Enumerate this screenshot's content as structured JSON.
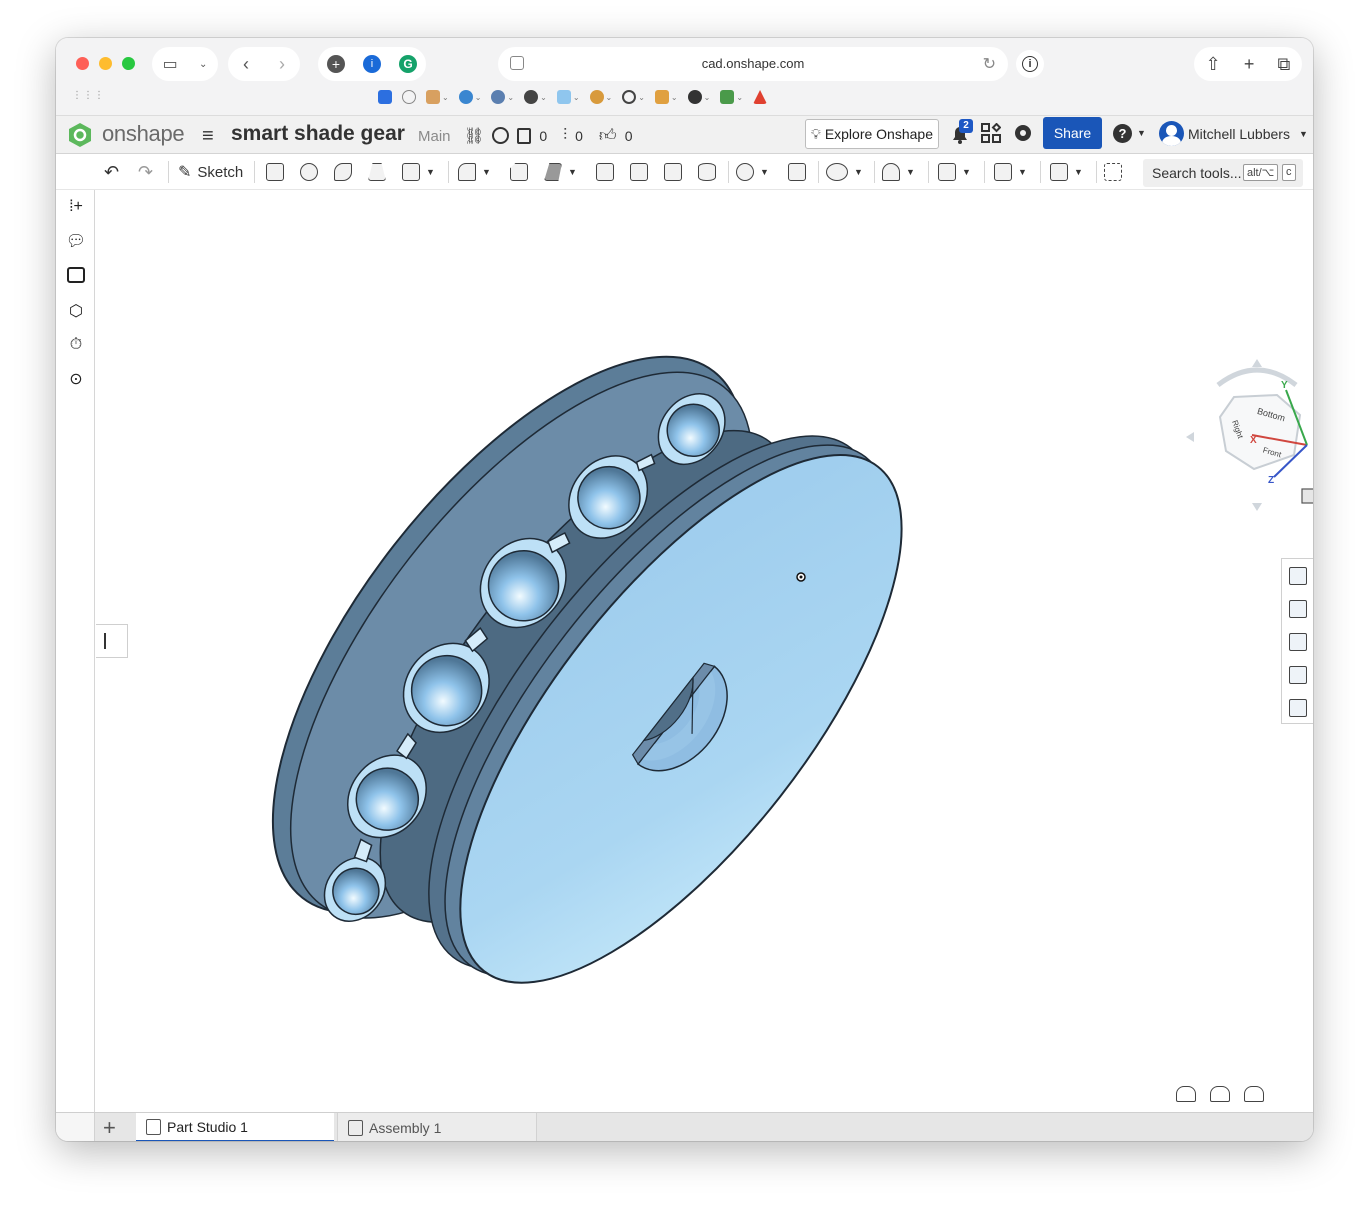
{
  "browser": {
    "url": "cad.onshape.com"
  },
  "header": {
    "brand": "onshape",
    "document_title": "smart shade gear",
    "branch": "Main",
    "copies_count": "0",
    "versions_count": "0",
    "likes_count": "0",
    "explore_label": "Explore Onshape",
    "notification_count": "2",
    "share_label": "Share",
    "help_label": "?",
    "user_name": "Mitchell Lubbers"
  },
  "toolbar": {
    "sketch_label": "Sketch",
    "search_placeholder": "Search tools...",
    "shortcut_modifier": "alt/⌥",
    "shortcut_key": "c"
  },
  "viewcube": {
    "face_top": "Bottom",
    "face_front": "Front",
    "face_right": "Right",
    "axis_x": "X",
    "axis_y": "Y",
    "axis_z": "Z"
  },
  "tabs": [
    {
      "label": "Part Studio 1",
      "active": true
    },
    {
      "label": "Assembly 1",
      "active": false
    }
  ],
  "colors": {
    "accent": "#1a56b8",
    "part_face": "#a9d1ef",
    "part_side": "#5f7f9a"
  }
}
